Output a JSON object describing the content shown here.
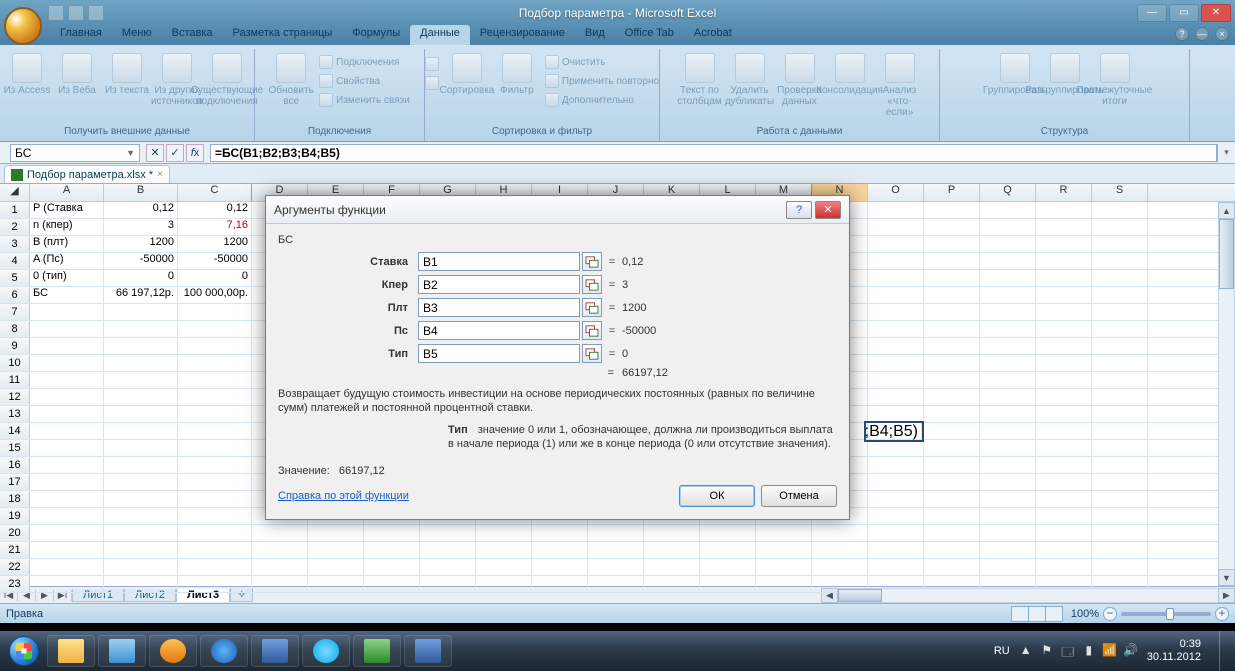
{
  "window": {
    "title": "Подбор параметра - Microsoft Excel"
  },
  "ribbon_tabs": [
    "Главная",
    "Меню",
    "Вставка",
    "Разметка страницы",
    "Формулы",
    "Данные",
    "Рецензирование",
    "Вид",
    "Office Tab",
    "Acrobat"
  ],
  "active_ribbon_tab": 5,
  "ribbon_groups": {
    "g1": {
      "caption": "Получить внешние данные",
      "btns": [
        "Из Access",
        "Из Веба",
        "Из текста",
        "Из других источников",
        "Существующие подключения"
      ]
    },
    "g2": {
      "caption": "Подключения",
      "refresh": "Обновить все",
      "items": [
        "Подключения",
        "Свойства",
        "Изменить связи"
      ]
    },
    "g3": {
      "caption": "Сортировка и фильтр",
      "sort": "Сортировка",
      "filter": "Фильтр",
      "items": [
        "Очистить",
        "Применить повторно",
        "Дополнительно"
      ]
    },
    "g4": {
      "caption": "Работа с данными",
      "btns": [
        "Текст по столбцам",
        "Удалить дубликаты",
        "Проверка данных",
        "Консолидация",
        "Анализ «что-если»"
      ]
    },
    "g5": {
      "caption": "Структура",
      "btns": [
        "Группировать",
        "Разгруппировать",
        "Промежуточные итоги"
      ]
    }
  },
  "namebox": "БС",
  "formula": "=БС(B1;B2;B3;B4;B5)",
  "doc_tab": "Подбор параметра.xlsx *",
  "columns": [
    "A",
    "B",
    "C",
    "D",
    "E",
    "F",
    "G",
    "H",
    "I",
    "J",
    "K",
    "L",
    "M",
    "N",
    "O",
    "P",
    "Q",
    "R",
    "S"
  ],
  "rows": [
    {
      "n": "1",
      "A": "P",
      "A2": "(Ставка",
      "B": "0,12",
      "C": "0,12"
    },
    {
      "n": "2",
      "A": "n",
      "A2": "(кпер)",
      "B": "3",
      "C": "7,16",
      "Cred": true
    },
    {
      "n": "3",
      "A": "B",
      "A2": "(плт)",
      "B": "1200",
      "C": "1200"
    },
    {
      "n": "4",
      "A": "A",
      "A2": "(Пс)",
      "B": "-50000",
      "C": "-50000"
    },
    {
      "n": "5",
      "A": "0",
      "A2": "(тип)",
      "B": "0",
      "C": "0"
    },
    {
      "n": "6",
      "A": "",
      "A2": "БС",
      "B": "66 197,12р.",
      "C": "100 000,00р."
    }
  ],
  "formula_cell_display": ";B4;B5)",
  "sheet_tabs": [
    "Лист1",
    "Лист2",
    "Лист3"
  ],
  "active_sheet": 2,
  "status": "Правка",
  "zoom": "100%",
  "dialog": {
    "title": "Аргументы функции",
    "func": "БС",
    "args": [
      {
        "label": "Ставка",
        "input": "B1",
        "value": "0,12"
      },
      {
        "label": "Кпер",
        "input": "B2",
        "value": "3"
      },
      {
        "label": "Плт",
        "input": "B3",
        "value": "1200"
      },
      {
        "label": "Пс",
        "input": "B4",
        "value": "-50000"
      },
      {
        "label": "Тип",
        "input": "B5",
        "value": "0"
      }
    ],
    "result_inline": "66197,12",
    "desc": "Возвращает будущую стоимость инвестиции на основе периодических постоянных (равных по величине сумм) платежей и постоянной процентной ставки.",
    "arg_name": "Тип",
    "arg_desc": "значение 0 или 1, обозначающее, должна ли производиться выплата в начале периода (1) или же в конце периода (0 или отсутствие значения).",
    "result_label": "Значение:",
    "result": "66197,12",
    "help": "Справка по этой функции",
    "ok": "ОК",
    "cancel": "Отмена"
  },
  "taskbar": {
    "lang": "RU",
    "time": "0:39",
    "date": "30.11.2012"
  }
}
